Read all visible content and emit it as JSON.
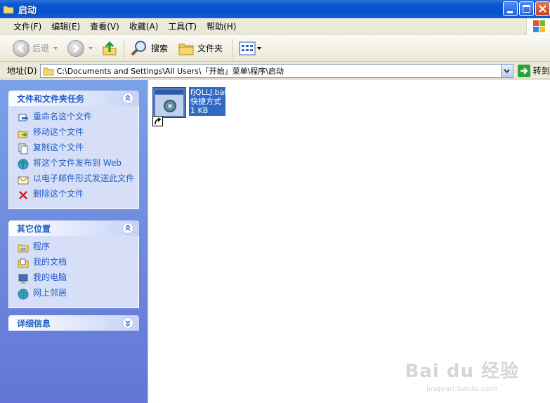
{
  "window": {
    "title": "启动"
  },
  "menu": [
    "文件(F)",
    "编辑(E)",
    "查看(V)",
    "收藏(A)",
    "工具(T)",
    "帮助(H)"
  ],
  "toolbar": {
    "back": "后退",
    "search": "搜索",
    "folders": "文件夹"
  },
  "address": {
    "label": "地址(D)",
    "path": "C:\\Documents and Settings\\All Users\\「开始」菜单\\程序\\启动",
    "go": "转到"
  },
  "file_tasks": {
    "title": "文件和文件夹任务",
    "items": [
      "重命名这个文件",
      "移动这个文件",
      "复制这个文件",
      "将这个文件发布到 Web",
      "以电子邮件形式发送此文件",
      "删除这个文件"
    ]
  },
  "other_places": {
    "title": "其它位置",
    "items": [
      "程序",
      "我的文档",
      "我的电脑",
      "网上邻居"
    ]
  },
  "details": {
    "title": "详细信息"
  },
  "file": {
    "name": "fjQLLJ.bat",
    "type": "快捷方式",
    "size": "1 KB"
  },
  "watermark": {
    "logo": "Bai du 经验",
    "url": "jingyan.baidu.com"
  },
  "colors": {
    "titlebar": "#0650cc",
    "task_link": "#215dc6",
    "selection": "#316ac5"
  }
}
